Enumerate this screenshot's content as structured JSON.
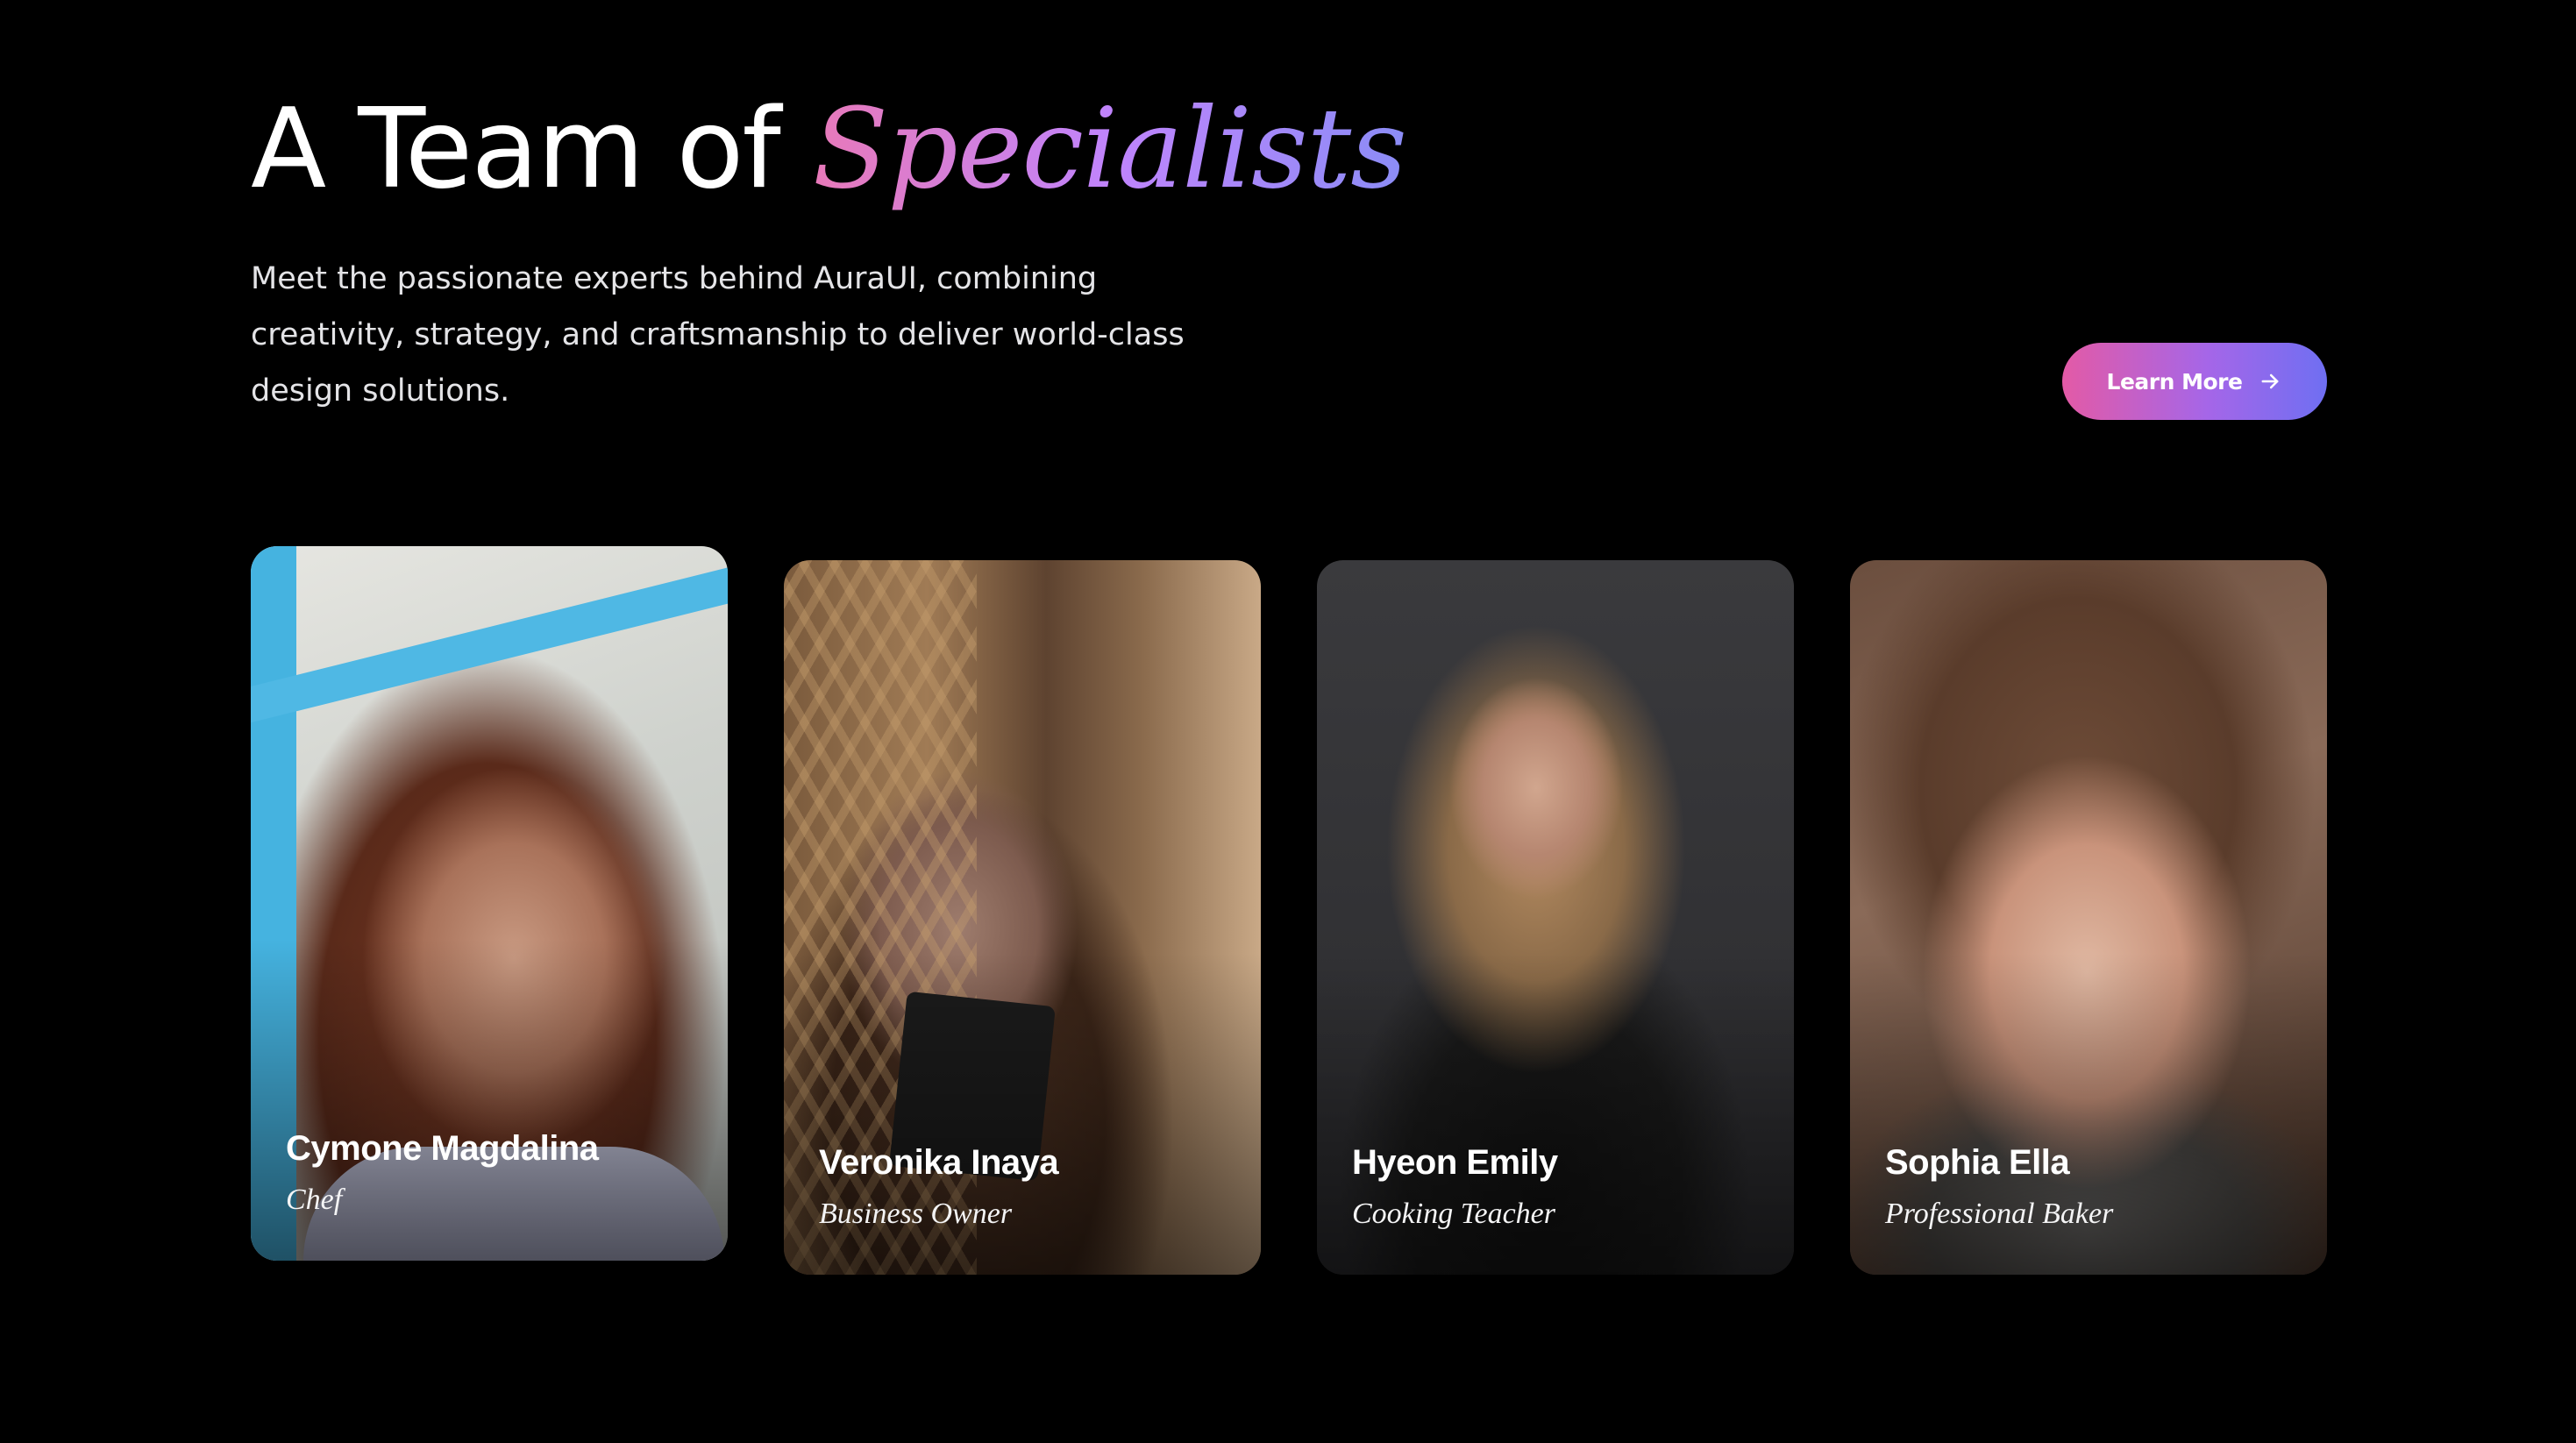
{
  "header": {
    "title_plain": "A Team of ",
    "title_accent": "Specialists",
    "description": "Meet the passionate experts behind AuraUI, combining creativity, strategy, and craftsmanship to deliver world-class design solutions."
  },
  "cta": {
    "label": "Learn More",
    "icon": "arrow-right-icon"
  },
  "colors": {
    "background": "#000000",
    "accent_gradient": [
      "#e35aa6",
      "#a566e8",
      "#6f6ff2"
    ]
  },
  "team": [
    {
      "name": "Cymone Magdalina",
      "role": "Chef"
    },
    {
      "name": "Veronika Inaya",
      "role": "Business Owner"
    },
    {
      "name": "Hyeon Emily",
      "role": "Cooking Teacher"
    },
    {
      "name": "Sophia Ella",
      "role": "Professional Baker"
    }
  ]
}
